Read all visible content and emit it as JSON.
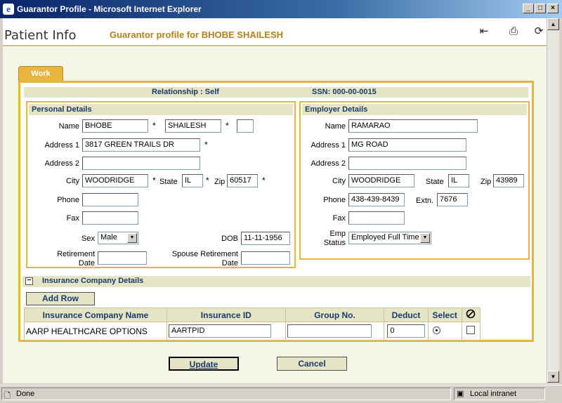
{
  "window": {
    "title": "Guarantor Profile - Microsoft Internet Explorer"
  },
  "header": {
    "title": "Patient Info",
    "subtitle": "Guarantor profile for BHOBE SHAILESH"
  },
  "tab": {
    "label": "Work"
  },
  "info_bar": {
    "relationship": "Relationship : Self",
    "ssn": "SSN: 000-00-0015"
  },
  "personal": {
    "heading": "Personal Details",
    "name_label": "Name",
    "last_name": "BHOBE",
    "first_name": "SHAILESH",
    "middle_initial": "",
    "address1_label": "Address 1",
    "address1": "3817 GREEN TRAILS DR",
    "address2_label": "Address 2",
    "address2": "",
    "city_label": "City",
    "city": "WOODRIDGE",
    "state_label": "State",
    "state": "IL",
    "zip_label": "Zip",
    "zip": "60517",
    "phone_label": "Phone",
    "phone": "",
    "fax_label": "Fax",
    "fax": "",
    "sex_label": "Sex",
    "sex": "Male",
    "dob_label": "DOB",
    "dob": "11-11-1956",
    "retirement_label_1": "Retirement",
    "retirement_label_2": "Date",
    "retirement": "",
    "spouse_label_1": "Spouse Retirement",
    "spouse_label_2": "Date",
    "spouse_retirement": "",
    "required_mark": "*"
  },
  "employer": {
    "heading": "Employer Details",
    "name_label": "Name",
    "name": "RAMARAO",
    "address1_label": "Address 1",
    "address1": "MG ROAD",
    "address2_label": "Address 2",
    "address2": "",
    "city_label": "City",
    "city": "WOODRIDGE",
    "state_label": "State",
    "state": "IL",
    "zip_label": "Zip",
    "zip": "43989",
    "phone_label": "Phone",
    "phone": "438-439-8439",
    "extn_label": "Extn.",
    "extn": "7676",
    "fax_label": "Fax",
    "fax": "",
    "emp_status_label_1": "Emp",
    "emp_status_label_2": "Status",
    "emp_status": "Employed Full Time"
  },
  "insurance": {
    "heading": "Insurance Company Details",
    "collapse_glyph": "−",
    "add_row_label": "Add Row",
    "columns": [
      "Insurance Company Name",
      "Insurance ID",
      "Group No.",
      "Deduct",
      "Select"
    ],
    "rows": [
      {
        "company": "AARP HEALTHCARE OPTIONS",
        "insurance_id": "AARTPID",
        "group_no": "",
        "deduct": "0"
      }
    ]
  },
  "actions": {
    "update_label": "Update",
    "cancel_label": "Cancel"
  },
  "statusbar": {
    "status": "Done",
    "zone": "Local intranet"
  }
}
